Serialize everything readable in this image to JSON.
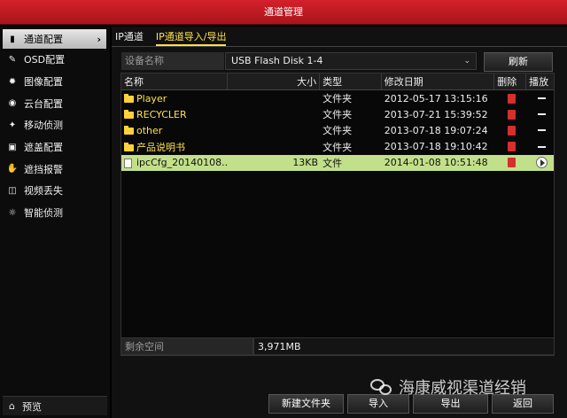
{
  "window": {
    "title": "通道管理"
  },
  "sidebar": {
    "items": [
      {
        "label": "通道配置",
        "icon": "camera-icon",
        "active": true
      },
      {
        "label": "OSD配置",
        "icon": "edit-icon"
      },
      {
        "label": "图像配置",
        "icon": "image-icon"
      },
      {
        "label": "云台配置",
        "icon": "ptz-icon"
      },
      {
        "label": "移动侦测",
        "icon": "motion-icon"
      },
      {
        "label": "遮盖配置",
        "icon": "mask-icon"
      },
      {
        "label": "遮挡报警",
        "icon": "hand-icon"
      },
      {
        "label": "视频丢失",
        "icon": "video-loss-icon"
      },
      {
        "label": "智能侦测",
        "icon": "smart-detect-icon"
      }
    ],
    "preview": {
      "label": "预览",
      "icon": "home-icon"
    }
  },
  "tabs": [
    {
      "label": "IP通道",
      "active": false
    },
    {
      "label": "IP通道导入/导出",
      "active": true
    }
  ],
  "device": {
    "label": "设备名称",
    "value": "USB Flash Disk 1-4",
    "refresh_label": "刷新"
  },
  "table": {
    "headers": {
      "name": "名称",
      "size": "大小",
      "type": "类型",
      "date": "修改日期",
      "delete": "删除",
      "play": "播放"
    },
    "rows": [
      {
        "name": "Player",
        "size": "",
        "type": "文件夹",
        "date": "2012-05-17 13:15:16",
        "kind": "folder"
      },
      {
        "name": "RECYCLER",
        "size": "",
        "type": "文件夹",
        "date": "2013-07-21 15:39:52",
        "kind": "folder"
      },
      {
        "name": "other",
        "size": "",
        "type": "文件夹",
        "date": "2013-07-18 19:07:24",
        "kind": "folder"
      },
      {
        "name": "产品说明书",
        "size": "",
        "type": "文件夹",
        "date": "2013-07-18 19:10:42",
        "kind": "folder"
      },
      {
        "name": "ipcCfg_20140108...",
        "size": "13KB",
        "type": "文件",
        "date": "2014-01-08 10:51:48",
        "kind": "file",
        "selected": true
      }
    ]
  },
  "free_space": {
    "label": "剩余空间",
    "value": "3,971MB"
  },
  "buttons": {
    "new_folder": "新建文件夹",
    "import": "导入",
    "export": "导出",
    "back": "返回"
  },
  "watermark": {
    "text": "海康威视渠道经销"
  },
  "colors": {
    "title_red": "#c41c26",
    "selected_row": "#c2e08a",
    "accent_yellow": "#ffe14a"
  }
}
